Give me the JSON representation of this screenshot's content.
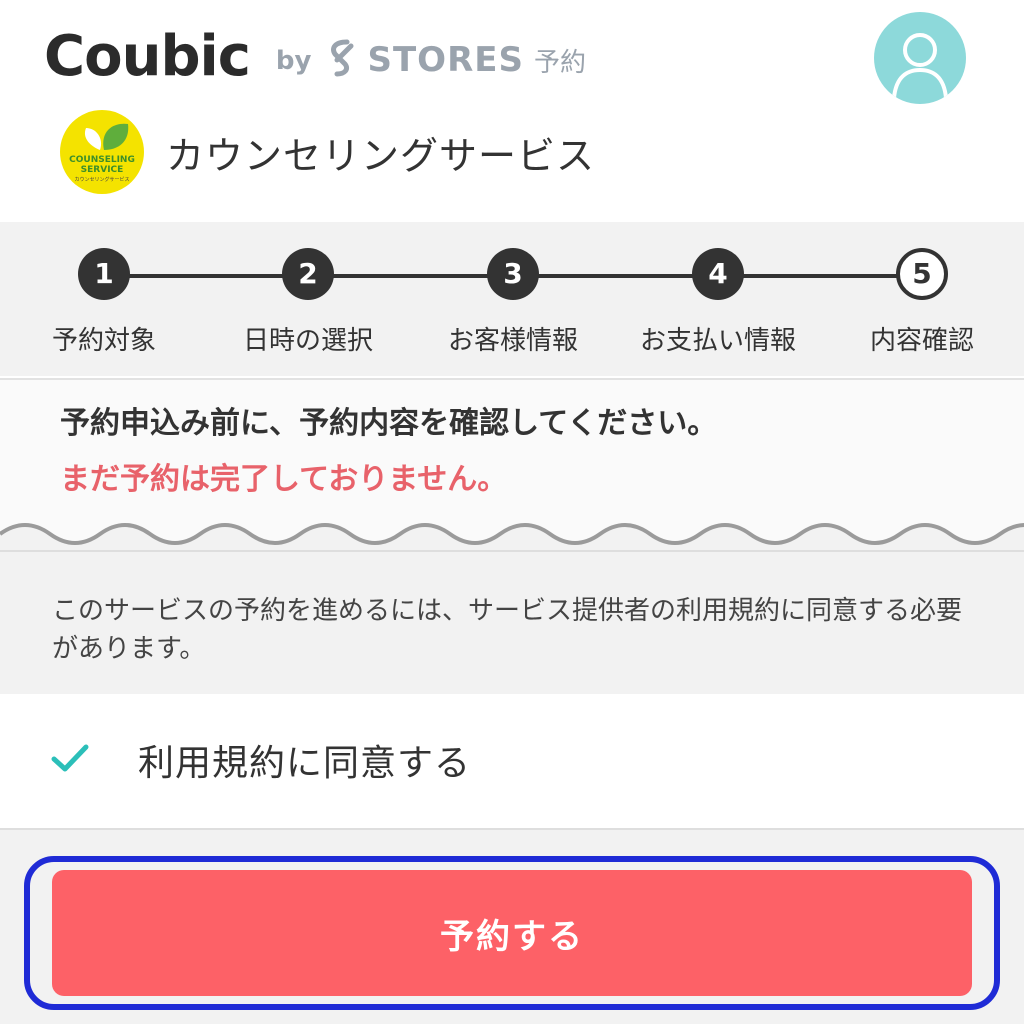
{
  "header": {
    "brand": "Coubic",
    "by": "by",
    "partner": "STORES",
    "partner_suffix": "予約",
    "shop_name": "カウンセリングサービス",
    "shop_logo_text_1": "COUNSELING",
    "shop_logo_text_2": "SERVICE",
    "shop_logo_text_3": "カウンセリングサービス"
  },
  "stepper": {
    "steps": [
      {
        "number": "1",
        "label": "予約対象"
      },
      {
        "number": "2",
        "label": "日時の選択"
      },
      {
        "number": "3",
        "label": "お客様情報"
      },
      {
        "number": "4",
        "label": "お支払い情報"
      },
      {
        "number": "5",
        "label": "内容確認"
      }
    ],
    "current_step": 5
  },
  "notice": {
    "confirm_text": "予約申込み前に、予約内容を確認してください。",
    "warning_text": "まだ予約は完了しておりません。"
  },
  "terms": {
    "text": "このサービスの予約を進めるには、サービス提供者の利用規約に同意する必要があります。"
  },
  "agree": {
    "label": "利用規約に同意する",
    "checked": true
  },
  "submit": {
    "label": "予約する"
  },
  "colors": {
    "accent_red": "#fd6167",
    "warning_red": "#e8626a",
    "check_teal": "#2bbfb9",
    "avatar_bg": "#8dd9da",
    "focus_ring": "#1f2bd6"
  }
}
